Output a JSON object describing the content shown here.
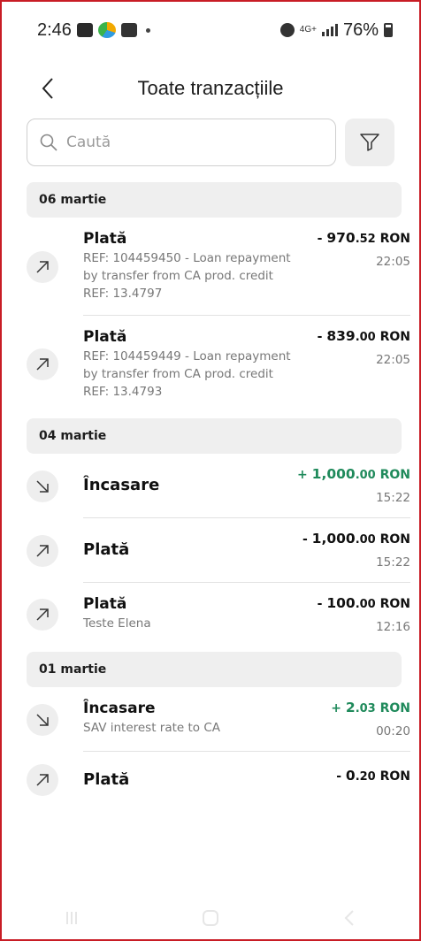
{
  "status_bar": {
    "time": "2:46",
    "network": "4G+",
    "battery": "76%"
  },
  "header": {
    "title": "Toate tranzacțiile"
  },
  "search": {
    "placeholder": "Caută"
  },
  "icons": {
    "back": "chevron-left-icon",
    "search": "search-icon",
    "filter": "filter-icon",
    "outgoing": "arrow-up-right-icon",
    "incoming": "arrow-down-right-icon"
  },
  "colors": {
    "positive": "#1f8a5b",
    "accent_border": "#c81d25"
  },
  "groups": [
    {
      "date": "06 martie",
      "transactions": [
        {
          "direction": "out",
          "title": "Plată",
          "desc": "REF: 104459450 - Loan repayment by transfer from CA prod. credit REF: 13.4797",
          "sign": "- ",
          "amount_int": "970",
          "amount_dec": ".52",
          "currency": " RON",
          "time": "22:05"
        },
        {
          "direction": "out",
          "title": "Plată",
          "desc": "REF: 104459449 - Loan repayment by transfer from CA prod. credit REF: 13.4793",
          "sign": "- ",
          "amount_int": "839",
          "amount_dec": ".00",
          "currency": " RON",
          "time": "22:05"
        }
      ]
    },
    {
      "date": "04 martie",
      "transactions": [
        {
          "direction": "in",
          "title": "Încasare",
          "desc": "",
          "sign": "+ ",
          "amount_int": "1,000",
          "amount_dec": ".00",
          "currency": " RON",
          "time": "15:22"
        },
        {
          "direction": "out",
          "title": "Plată",
          "desc": "",
          "sign": "- ",
          "amount_int": "1,000",
          "amount_dec": ".00",
          "currency": " RON",
          "time": "15:22"
        },
        {
          "direction": "out",
          "title": "Plată",
          "desc": "Teste Elena",
          "sign": "- ",
          "amount_int": "100",
          "amount_dec": ".00",
          "currency": " RON",
          "time": "12:16"
        }
      ]
    },
    {
      "date": "01 martie",
      "transactions": [
        {
          "direction": "in",
          "title": "Încasare",
          "desc": "SAV interest rate to CA",
          "sign": "+ ",
          "amount_int": "2",
          "amount_dec": ".03",
          "currency": " RON",
          "time": "00:20"
        },
        {
          "direction": "out",
          "title": "Plată",
          "desc": "",
          "sign": "- ",
          "amount_int": "0",
          "amount_dec": ".20",
          "currency": " RON",
          "time": ""
        }
      ]
    }
  ]
}
